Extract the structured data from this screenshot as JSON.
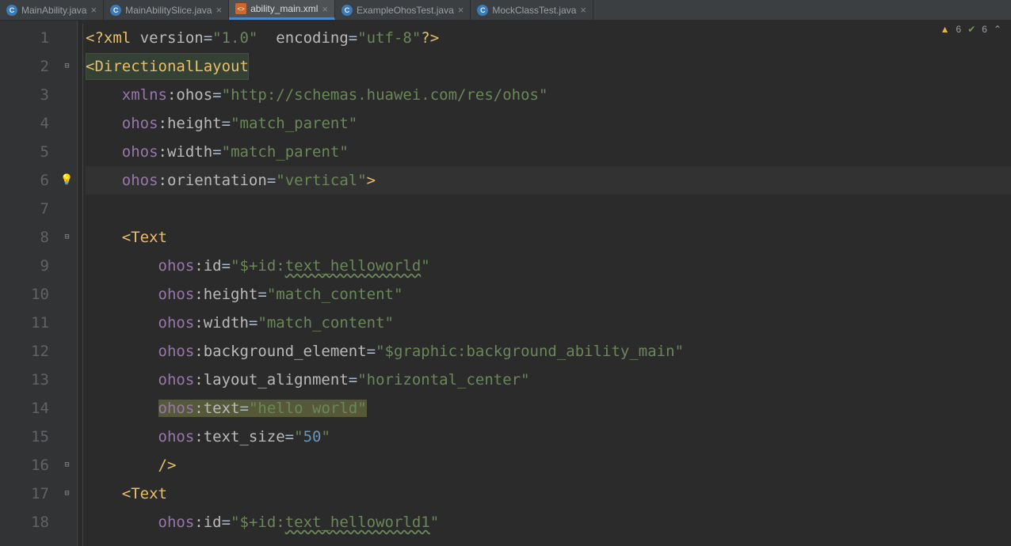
{
  "tabs": [
    {
      "label": "MainAbility.java",
      "iconLetter": "C",
      "iconKind": "c"
    },
    {
      "label": "MainAbilitySlice.java",
      "iconLetter": "C",
      "iconKind": "c"
    },
    {
      "label": "ability_main.xml",
      "iconLetter": "<>",
      "iconKind": "xml",
      "active": true
    },
    {
      "label": "ExampleOhosTest.java",
      "iconLetter": "C",
      "iconKind": "c"
    },
    {
      "label": "MockClassTest.java",
      "iconLetter": "C",
      "iconKind": "c"
    }
  ],
  "inspections": {
    "warningCount": "6",
    "passCount": "6"
  },
  "lines": [
    {
      "n": "1",
      "mark": "",
      "tokens": [
        [
          "pi",
          "<?xml"
        ],
        [
          "attr",
          " version"
        ],
        [
          "eq",
          "="
        ],
        [
          "str",
          "\"1.0\""
        ],
        [
          "attr",
          "  encoding"
        ],
        [
          "eq",
          "="
        ],
        [
          "str",
          "\"utf-8\""
        ],
        [
          "pi",
          "?>"
        ]
      ]
    },
    {
      "n": "2",
      "mark": "fold-open",
      "taghl": true,
      "tagwidth": "268px",
      "tokens": [
        [
          "punct",
          "<"
        ],
        [
          "tag",
          "DirectionalLayout"
        ]
      ]
    },
    {
      "n": "3",
      "mark": "",
      "tokens": [
        [
          "sp",
          "    "
        ],
        [
          "ns",
          "xmlns"
        ],
        [
          "attr",
          ":ohos"
        ],
        [
          "eq",
          "="
        ],
        [
          "str",
          "\"http://schemas.huawei.com/res/ohos\""
        ]
      ]
    },
    {
      "n": "4",
      "mark": "",
      "tokens": [
        [
          "sp",
          "    "
        ],
        [
          "ns",
          "ohos"
        ],
        [
          "attr",
          ":height"
        ],
        [
          "eq",
          "="
        ],
        [
          "str",
          "\"match_parent\""
        ]
      ]
    },
    {
      "n": "5",
      "mark": "",
      "tokens": [
        [
          "sp",
          "    "
        ],
        [
          "ns",
          "ohos"
        ],
        [
          "attr",
          ":width"
        ],
        [
          "eq",
          "="
        ],
        [
          "str",
          "\"match_parent\""
        ]
      ]
    },
    {
      "n": "6",
      "mark": "bulb",
      "hl": true,
      "tokens": [
        [
          "sp",
          "    "
        ],
        [
          "ns",
          "ohos"
        ],
        [
          "attr",
          ":orientation"
        ],
        [
          "eq",
          "="
        ],
        [
          "str",
          "\"vertical\""
        ],
        [
          "punct",
          ">"
        ]
      ]
    },
    {
      "n": "7",
      "mark": "",
      "tokens": []
    },
    {
      "n": "8",
      "mark": "fold-open",
      "tokens": [
        [
          "sp",
          "    "
        ],
        [
          "punct",
          "<"
        ],
        [
          "tag",
          "Text"
        ]
      ]
    },
    {
      "n": "9",
      "mark": "",
      "tokens": [
        [
          "sp",
          "        "
        ],
        [
          "ns",
          "ohos"
        ],
        [
          "attr",
          ":id"
        ],
        [
          "eq",
          "="
        ],
        [
          "str",
          "\"$+id:"
        ],
        [
          "wavy",
          "text_helloworld"
        ],
        [
          "str",
          "\""
        ]
      ]
    },
    {
      "n": "10",
      "mark": "",
      "tokens": [
        [
          "sp",
          "        "
        ],
        [
          "ns",
          "ohos"
        ],
        [
          "attr",
          ":height"
        ],
        [
          "eq",
          "="
        ],
        [
          "str",
          "\"match_content\""
        ]
      ]
    },
    {
      "n": "11",
      "mark": "",
      "tokens": [
        [
          "sp",
          "        "
        ],
        [
          "ns",
          "ohos"
        ],
        [
          "attr",
          ":width"
        ],
        [
          "eq",
          "="
        ],
        [
          "str",
          "\"match_content\""
        ]
      ]
    },
    {
      "n": "12",
      "mark": "",
      "tokens": [
        [
          "sp",
          "        "
        ],
        [
          "ns",
          "ohos"
        ],
        [
          "attr",
          ":background_element"
        ],
        [
          "eq",
          "="
        ],
        [
          "str",
          "\"$graphic:background_ability_main\""
        ]
      ]
    },
    {
      "n": "13",
      "mark": "",
      "tokens": [
        [
          "sp",
          "        "
        ],
        [
          "ns",
          "ohos"
        ],
        [
          "attr",
          ":layout_alignment"
        ],
        [
          "eq",
          "="
        ],
        [
          "str",
          "\"horizontal_center\""
        ]
      ]
    },
    {
      "n": "14",
      "mark": "",
      "selhl": true,
      "tokens": [
        [
          "sp",
          "        "
        ],
        [
          "selstart",
          ""
        ],
        [
          "ns",
          "ohos"
        ],
        [
          "attr",
          ":text"
        ],
        [
          "eq",
          "="
        ],
        [
          "str",
          "\"hello world\""
        ],
        [
          "selend",
          ""
        ]
      ]
    },
    {
      "n": "15",
      "mark": "",
      "tokens": [
        [
          "sp",
          "        "
        ],
        [
          "ns",
          "ohos"
        ],
        [
          "attr",
          ":text_size"
        ],
        [
          "eq",
          "="
        ],
        [
          "str",
          "\""
        ],
        [
          "strnum",
          "50"
        ],
        [
          "str",
          "\""
        ]
      ]
    },
    {
      "n": "16",
      "mark": "fold-close",
      "tokens": [
        [
          "sp",
          "        "
        ],
        [
          "punct",
          "/>"
        ]
      ]
    },
    {
      "n": "17",
      "mark": "fold-open",
      "tokens": [
        [
          "sp",
          "    "
        ],
        [
          "punct",
          "<"
        ],
        [
          "tag",
          "Text"
        ]
      ]
    },
    {
      "n": "18",
      "mark": "",
      "tokens": [
        [
          "sp",
          "        "
        ],
        [
          "ns",
          "ohos"
        ],
        [
          "attr",
          ":id"
        ],
        [
          "eq",
          "="
        ],
        [
          "str",
          "\"$+id:"
        ],
        [
          "wavy",
          "text_helloworld1"
        ],
        [
          "str",
          "\""
        ]
      ]
    }
  ]
}
